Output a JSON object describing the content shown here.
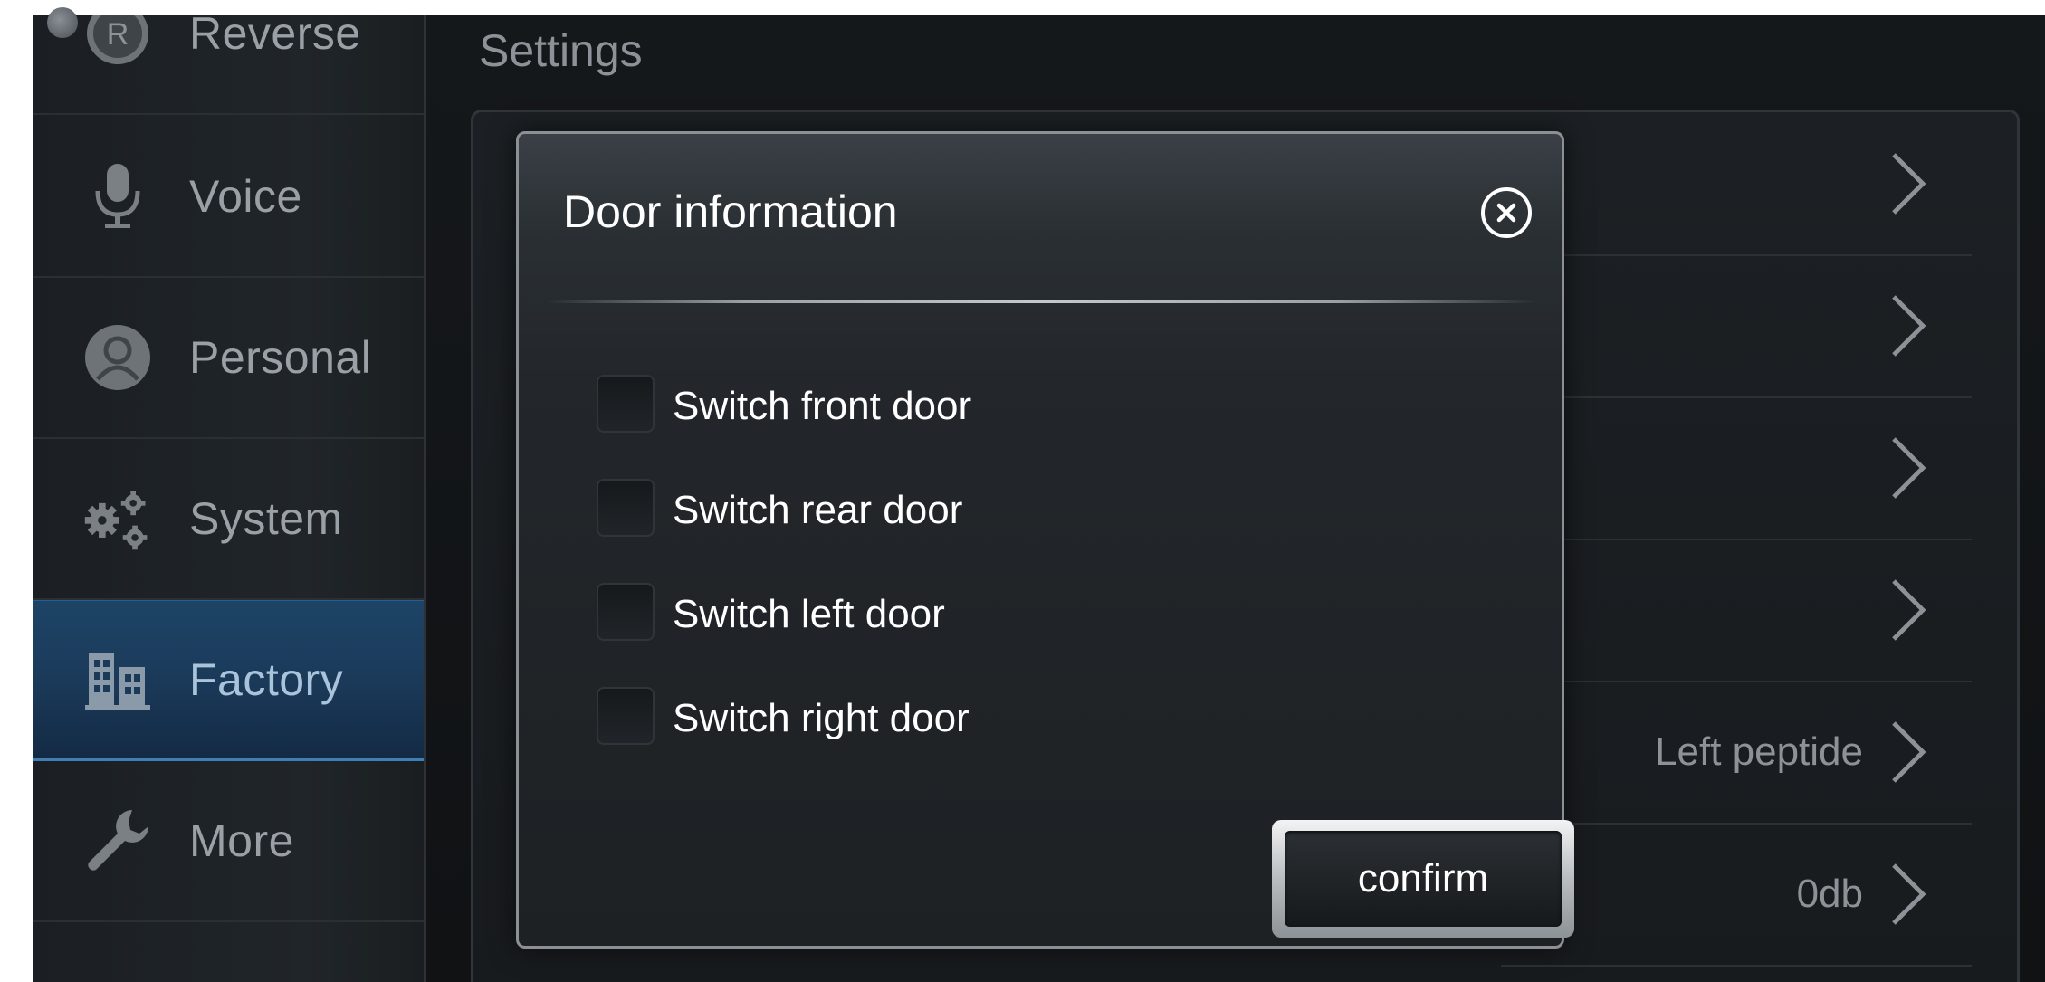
{
  "app": {
    "title": "Settings"
  },
  "sidebar": {
    "items": [
      {
        "label": "Reverse",
        "icon": "reverse-r-icon"
      },
      {
        "label": "Voice",
        "icon": "microphone-icon"
      },
      {
        "label": "Personal",
        "icon": "person-icon"
      },
      {
        "label": "System",
        "icon": "gears-icon"
      },
      {
        "label": "Factory",
        "icon": "factory-buildings-icon",
        "active": true
      },
      {
        "label": "More",
        "icon": "wrench-icon"
      }
    ]
  },
  "settings_list": {
    "rows": [
      {
        "value": ""
      },
      {
        "value": ""
      },
      {
        "value": ""
      },
      {
        "value": ""
      },
      {
        "value": "Left peptide"
      },
      {
        "value": "0db"
      }
    ]
  },
  "dialog": {
    "title": "Door information",
    "options": [
      {
        "label": "Switch front door",
        "checked": false
      },
      {
        "label": "Switch rear door",
        "checked": false
      },
      {
        "label": "Switch left door",
        "checked": false
      },
      {
        "label": "Switch right door",
        "checked": false
      }
    ],
    "confirm_label": "confirm"
  },
  "colors": {
    "background": "#15181b",
    "active_nav": "#1b3a5a",
    "text_primary": "#ffffff",
    "text_muted": "#9aa0a6"
  }
}
